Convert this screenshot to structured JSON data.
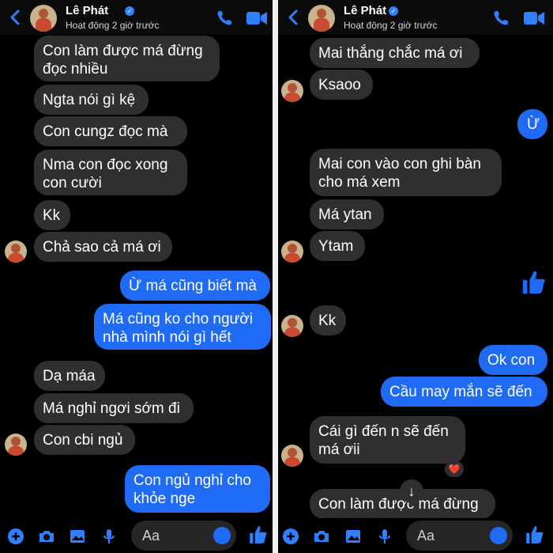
{
  "header": {
    "name": "Lê Phát",
    "status": "Hoạt động 2 giờ trước"
  },
  "left_messages": [
    {
      "text": "Con làm được má đừng\nđọc nhiều",
      "side": "received"
    },
    {
      "text": "Ngta nói gì kệ",
      "side": "received"
    },
    {
      "text": "Con cungz đọc mà",
      "side": "received"
    },
    {
      "text": "Nma con đọc xong\ncon cười",
      "side": "received"
    },
    {
      "text": "Kk",
      "side": "received"
    },
    {
      "text": "Chả sao cả má ơi",
      "side": "received"
    },
    {
      "text": "Ừ má cũng biết mà",
      "side": "sent"
    },
    {
      "text": "Má cũng ko cho người\nnhà mình nói gì hết",
      "side": "sent"
    },
    {
      "text": "Dạ máa",
      "side": "received"
    },
    {
      "text": "Má nghỉ ngơi sớm đi",
      "side": "sent_but_received_style"
    },
    {
      "text": "Con cbi ngủ",
      "side": "received"
    },
    {
      "text": "Con ngủ nghỉ cho\nkhỏe nge",
      "side": "sent"
    }
  ],
  "right_messages": [
    {
      "text": "Mai thắng chắc má ơi",
      "side": "received"
    },
    {
      "text": "Ksaoo",
      "side": "received"
    },
    {
      "text": "Ừ",
      "side": "sent"
    },
    {
      "text": "Mai con vào con ghi bàn\ncho má xem",
      "side": "received"
    },
    {
      "text": "Má ytan",
      "side": "received"
    },
    {
      "text": "Ytam",
      "side": "received"
    },
    {
      "text": "Kk",
      "side": "received"
    },
    {
      "text": "Ok con",
      "side": "sent"
    },
    {
      "text": "Cầu may mắn sẽ đến",
      "side": "sent"
    },
    {
      "text": "Cái gì đến n sẽ đến\nmá ơii",
      "side": "received"
    },
    {
      "text": "Con làm được má đừng",
      "side": "received"
    }
  ],
  "composer": {
    "placeholder": "Aa"
  },
  "reaction": {
    "emoji": "❤️"
  },
  "colors": {
    "sent": "#1f6bf6",
    "received": "#2f2f2f",
    "accent": "#2f80ff"
  }
}
